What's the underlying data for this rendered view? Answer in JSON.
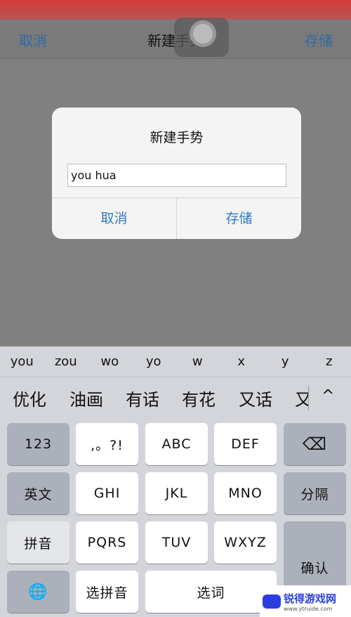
{
  "nav": {
    "cancel": "取消",
    "title": "新建手势",
    "save": "存储"
  },
  "dialog": {
    "title": "新建手势",
    "input_value": "you hua",
    "cancel": "取消",
    "save": "存储"
  },
  "keyboard": {
    "pinyin": [
      "you",
      "zou",
      "wo",
      "yo",
      "w",
      "x",
      "y",
      "z"
    ],
    "candidates": [
      "优化",
      "油画",
      "有话",
      "有花",
      "又话",
      "又"
    ],
    "expand": "^",
    "keys": {
      "num": "123",
      "punct": ",。?!",
      "abc": "ABC",
      "def": "DEF",
      "delete": "⌫",
      "en": "英文",
      "ghi": "GHI",
      "jkl": "JKL",
      "mno": "MNO",
      "sep": "分隔",
      "pinyin": "拼音",
      "pqrs": "PQRS",
      "tuv": "TUV",
      "wxyz": "WXYZ",
      "confirm": "确认",
      "globe": "🌐",
      "select_pinyin": "选拼音",
      "select_word": "选词"
    }
  },
  "watermark": {
    "name": "锐得游戏网",
    "url": "www.ytruide.com"
  }
}
